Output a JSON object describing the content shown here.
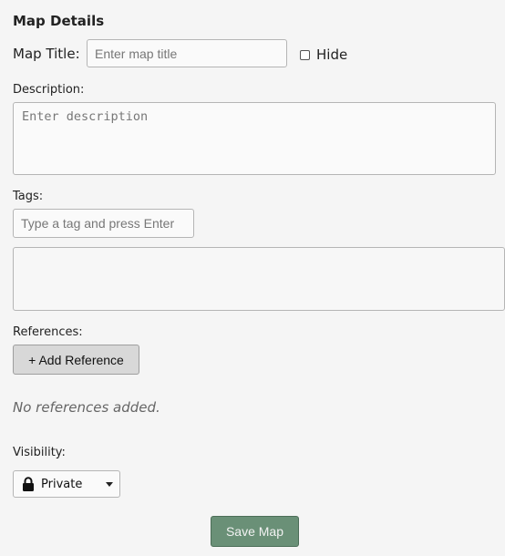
{
  "section": {
    "title": "Map Details"
  },
  "map_title": {
    "label": "Map Title:",
    "placeholder": "Enter map title",
    "value": ""
  },
  "hide": {
    "label": "Hide",
    "checked": false
  },
  "description": {
    "label": "Description:",
    "placeholder": "Enter description",
    "value": ""
  },
  "tags": {
    "label": "Tags:",
    "placeholder": "Type a tag and press Enter",
    "items": []
  },
  "references": {
    "label": "References:",
    "add_label": "+ Add Reference",
    "empty_text": "No references added."
  },
  "visibility": {
    "label": "Visibility:",
    "selected": "Private",
    "icon": "lock-icon"
  },
  "actions": {
    "save_label": "Save Map",
    "save_color": "#6a9077"
  }
}
